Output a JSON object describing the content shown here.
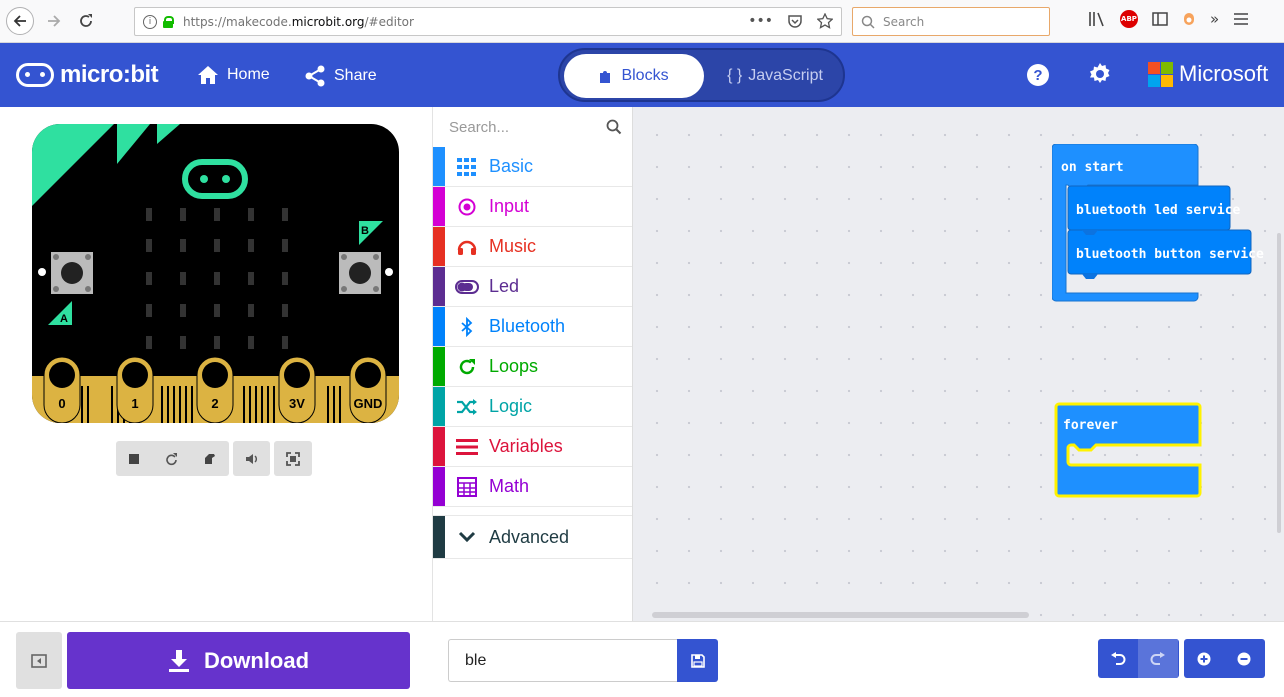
{
  "browser": {
    "url_prefix": "https://makecode.",
    "url_host": "microbit.org",
    "url_path": "/#editor",
    "search_placeholder": "Search",
    "more_icon": "•••",
    "abp_label": "ABP"
  },
  "header": {
    "logo_text": "micro:bit",
    "home_label": "Home",
    "share_label": "Share",
    "blocks_label": "Blocks",
    "js_label": "JavaScript",
    "help_label": "?",
    "brand_label": "Microsoft"
  },
  "simulator": {
    "button_a": "A",
    "button_b": "B",
    "pins": [
      "0",
      "1",
      "2",
      "3V",
      "GND"
    ]
  },
  "toolbox": {
    "search_placeholder": "Search...",
    "categories": [
      {
        "label": "Basic",
        "color": "#1e90ff"
      },
      {
        "label": "Input",
        "color": "#d400d4"
      },
      {
        "label": "Music",
        "color": "#e63022"
      },
      {
        "label": "Led",
        "color": "#5c2d91"
      },
      {
        "label": "Bluetooth",
        "color": "#0082fb"
      },
      {
        "label": "Loops",
        "color": "#00aa00"
      },
      {
        "label": "Logic",
        "color": "#00a4a6"
      },
      {
        "label": "Variables",
        "color": "#dc143c"
      },
      {
        "label": "Math",
        "color": "#9400d3"
      }
    ],
    "advanced_label": "Advanced"
  },
  "workspace": {
    "on_start_label": "on start",
    "led_service_label": "bluetooth led service",
    "button_service_label": "bluetooth button service",
    "forever_label": "forever"
  },
  "footer": {
    "download_label": "Download",
    "project_name": "ble"
  },
  "colors": {
    "header_bg": "#3454d1",
    "download_bg": "#6633cc",
    "block_blue": "#1e90ff",
    "highlight": "#fff200"
  }
}
